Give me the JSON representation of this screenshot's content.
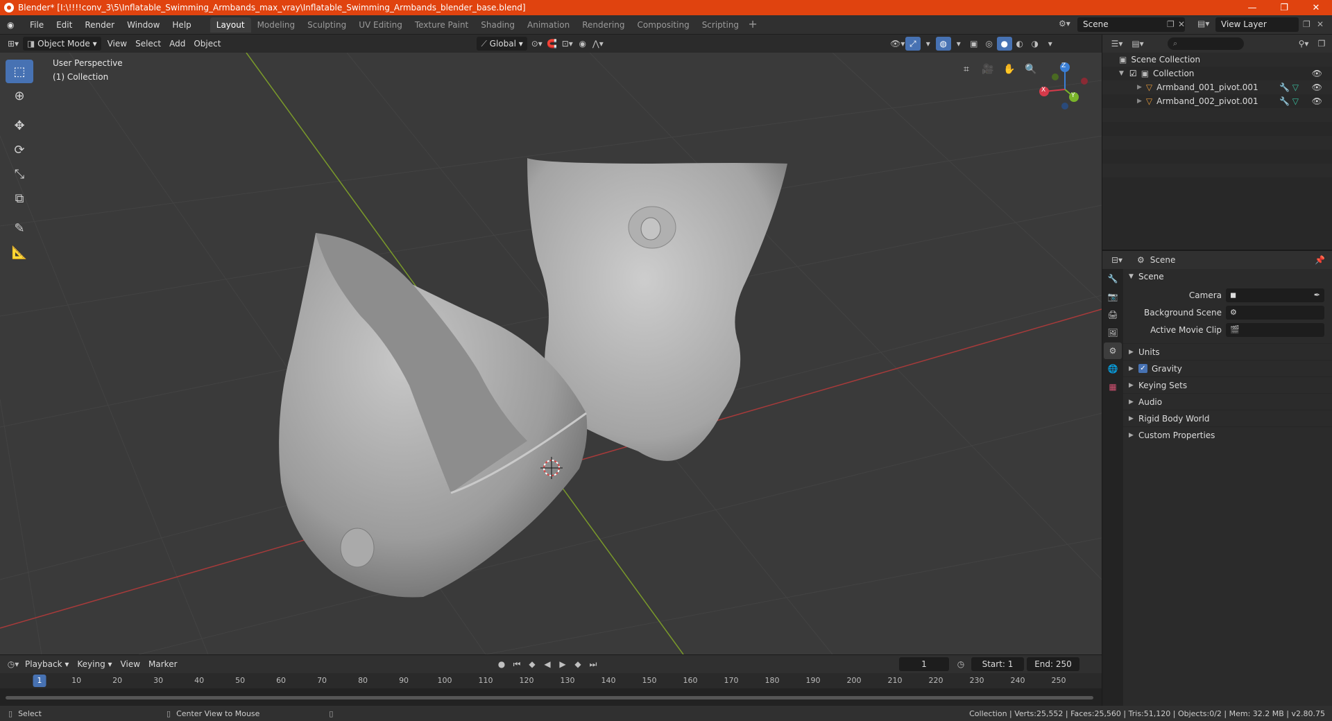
{
  "window": {
    "title": "Blender* [I:\\!!!!conv_3\\5\\Inflatable_Swimming_Armbands_max_vray\\Inflatable_Swimming_Armbands_blender_base.blend]",
    "minimize": "—",
    "maximize": "❐",
    "close": "✕"
  },
  "menu": [
    "File",
    "Edit",
    "Render",
    "Window",
    "Help"
  ],
  "workspaces": [
    "Layout",
    "Modeling",
    "Sculpting",
    "UV Editing",
    "Texture Paint",
    "Shading",
    "Animation",
    "Rendering",
    "Compositing",
    "Scripting"
  ],
  "active_workspace": "Layout",
  "scene_name": "Scene",
  "view_layer": "View Layer",
  "viewport_header": {
    "mode": "Object Mode",
    "menus": [
      "View",
      "Select",
      "Add",
      "Object"
    ],
    "transform_orientation": "Global"
  },
  "viewport": {
    "perspective_label": "User Perspective",
    "collection_label": "(1) Collection",
    "gizmo_axes": [
      "X",
      "Y",
      "Z"
    ],
    "colors": {
      "background": "#3a3a3a",
      "grid": "#444444",
      "x_axis": "#a83a3a",
      "y_axis": "#7a9a2a",
      "mesh": "#a8a8a8",
      "accent": "#4772b3"
    }
  },
  "outliner": {
    "root": "Scene Collection",
    "collection": "Collection",
    "objects": [
      "Armband_001_pivot.001",
      "Armband_002_pivot.001"
    ]
  },
  "properties": {
    "context": "Scene",
    "panel": "Scene",
    "fields": [
      {
        "label": "Camera",
        "value": ""
      },
      {
        "label": "Background Scene",
        "value": ""
      },
      {
        "label": "Active Movie Clip",
        "value": ""
      }
    ],
    "subpanels": [
      "Units",
      "Gravity",
      "Keying Sets",
      "Audio",
      "Rigid Body World",
      "Custom Properties"
    ]
  },
  "timeline": {
    "menus": [
      "Playback",
      "Keying",
      "View",
      "Marker"
    ],
    "current_frame": "1",
    "start_label": "Start:",
    "start": "1",
    "end_label": "End:",
    "end": "250",
    "ticks": [
      "10",
      "20",
      "30",
      "40",
      "50",
      "60",
      "70",
      "80",
      "90",
      "100",
      "110",
      "120",
      "130",
      "140",
      "150",
      "160",
      "170",
      "180",
      "190",
      "200",
      "210",
      "220",
      "230",
      "240",
      "250"
    ]
  },
  "statusbar": {
    "left_action": "Select",
    "middle_action": "Center View to Mouse",
    "stats": "Collection | Verts:25,552 | Faces:25,560 | Tris:51,120 | Objects:0/2 | Mem: 32.2 MB | v2.80.75"
  }
}
